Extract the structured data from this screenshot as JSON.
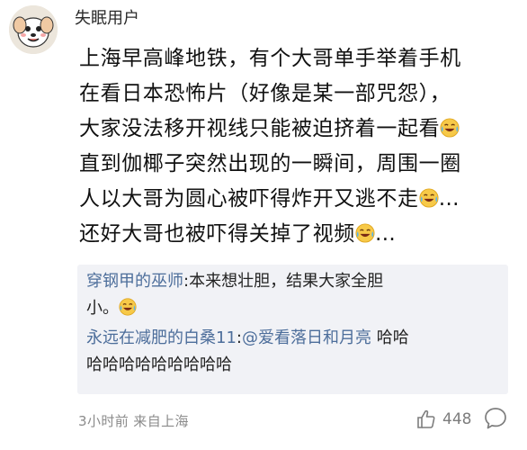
{
  "post": {
    "username": "失眠用户",
    "lines": [
      "上海早高峰地铁，有个大哥单手举着手机",
      "在看日本恐怖片（好像是某一部咒怨），",
      "大家没法移开视线只能被迫挤着一起看",
      "直到伽椰子突然出现的一瞬间，周围一圈",
      "人以大哥为圆心被吓得炸开又逃不走",
      "还好大哥也被吓得关掉了视频"
    ],
    "ellipsis": "…"
  },
  "replies": [
    {
      "author": "穿钢甲的巫师",
      "sep": ":",
      "text_line1": "本来想壮胆，结果大家全胆",
      "text_line2": "小。"
    },
    {
      "author": "永远在减肥的白桑11",
      "sep": ":",
      "mention": "@爱看落日和月亮",
      "text_line1": " 哈哈",
      "text_line2": "哈哈哈哈哈哈哈哈哈"
    }
  ],
  "footer": {
    "time_source": "3小时前  来自上海",
    "likes": "448"
  },
  "icons": {
    "avatar": "cartoon-dog-avatar",
    "emoji": "laughing-crying-emoji",
    "like": "thumbs-up-icon",
    "comment": "comment-icon"
  }
}
